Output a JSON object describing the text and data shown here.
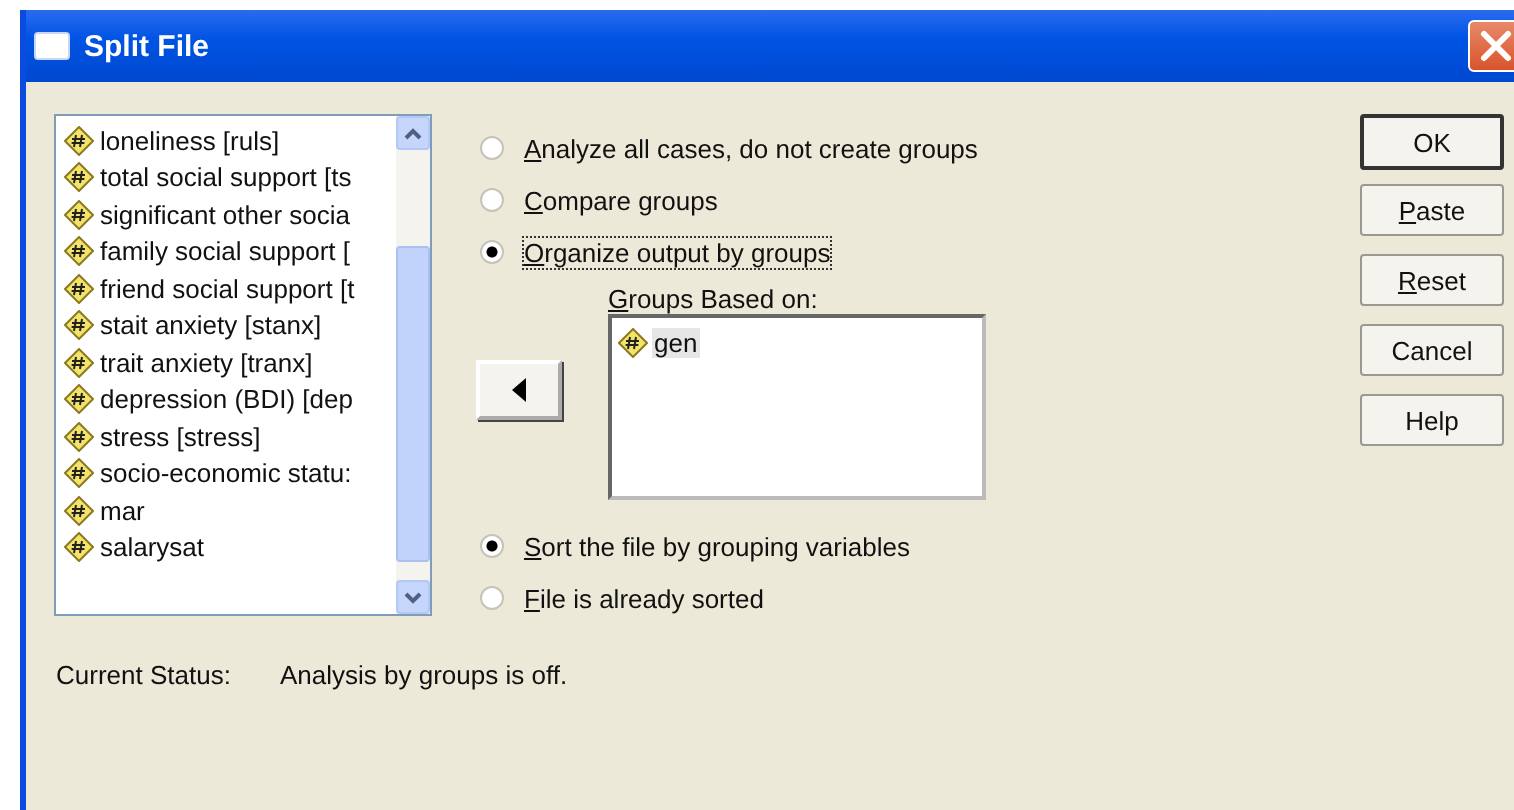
{
  "window": {
    "title": "Split File"
  },
  "variables": [
    {
      "label": "loneliness [ruls]",
      "selected": false
    },
    {
      "label": "total social support [ts",
      "selected": false
    },
    {
      "label": "significant other socia",
      "selected": false
    },
    {
      "label": "family social support [",
      "selected": false
    },
    {
      "label": "friend social support [t",
      "selected": false
    },
    {
      "label": "stait anxiety [stanx]",
      "selected": false
    },
    {
      "label": "trait anxiety [tranx]",
      "selected": false
    },
    {
      "label": "depression (BDI) [dep",
      "selected": false
    },
    {
      "label": "stress [stress]",
      "selected": false
    },
    {
      "label": "socio-economic statu:",
      "selected": false
    },
    {
      "label": "mar",
      "selected": false
    },
    {
      "label": "salarysat",
      "selected": false
    }
  ],
  "mode_options": [
    {
      "label": "Analyze all cases, do not create groups",
      "selected": false,
      "mnemonic": true,
      "focused": false
    },
    {
      "label": "Compare groups",
      "selected": false,
      "mnemonic": true,
      "focused": false
    },
    {
      "label": "Organize output by groups",
      "selected": true,
      "mnemonic": true,
      "focused": true
    }
  ],
  "groups_based_on": {
    "label": "Groups Based on:",
    "mnemonic": true,
    "items": [
      {
        "label": "gen",
        "selected": true
      }
    ]
  },
  "sort_options": [
    {
      "label": "Sort the file by grouping variables",
      "selected": true,
      "mnemonic": true
    },
    {
      "label": "File is already sorted",
      "selected": false,
      "mnemonic": true
    }
  ],
  "buttons": [
    {
      "label": "OK",
      "default": true,
      "mnemonic": false
    },
    {
      "label": "Paste",
      "default": false,
      "mnemonic": true
    },
    {
      "label": "Reset",
      "default": false,
      "mnemonic": true
    },
    {
      "label": "Cancel",
      "default": false,
      "mnemonic": false
    },
    {
      "label": "Help",
      "default": false,
      "mnemonic": false
    }
  ],
  "status": {
    "label": "Current Status:",
    "value": "Analysis by groups is off."
  }
}
